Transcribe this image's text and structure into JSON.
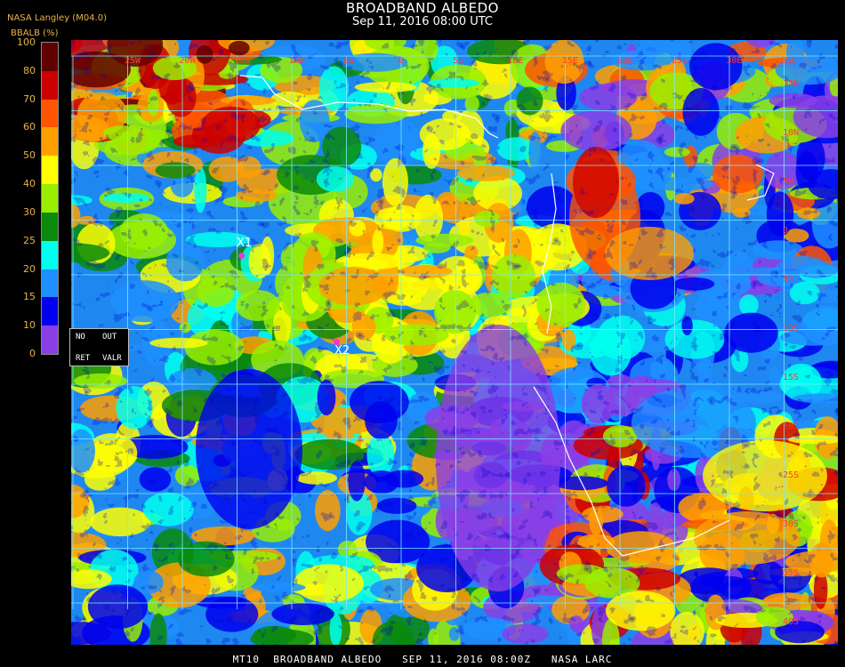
{
  "header": {
    "title": "BROADBAND ALBEDO",
    "subtitle": "Sep 11, 2016 08:00 UTC",
    "provider": "NASA Langley (M04.0)"
  },
  "colorbar": {
    "title": "BBALB (%)",
    "ticks": [
      "100",
      "80",
      "70",
      "60",
      "50",
      "40",
      "30",
      "25",
      "20",
      "15",
      "10",
      "0"
    ],
    "colors": [
      "#600000",
      "#cc0000",
      "#ff5500",
      "#ff9f00",
      "#ffff00",
      "#99ee00",
      "#0a8a0a",
      "#00ffee",
      "#1f8fff",
      "#0000ee",
      "#8a3fe6"
    ]
  },
  "controls": {
    "no": "NO",
    "out": "OUT",
    "ret": "RET",
    "valr": "VALR"
  },
  "markers": [
    {
      "label": "X1"
    },
    {
      "label": "X2"
    }
  ],
  "grid": {
    "top_labels": [
      "25W",
      "20W",
      "15W",
      "10W",
      "5W",
      "0",
      "5E",
      "10E",
      "15E",
      "20E",
      "25E",
      "30E",
      "35E"
    ],
    "right_labels": [
      "15N",
      "10N",
      "5N",
      "0",
      "5S",
      "10S",
      "15S",
      "20S",
      "25S",
      "30S",
      "35S",
      "40S"
    ]
  },
  "footer": "MT10  BROADBAND ALBEDO   SEP 11, 2016 08:00Z   NASA LARC"
}
